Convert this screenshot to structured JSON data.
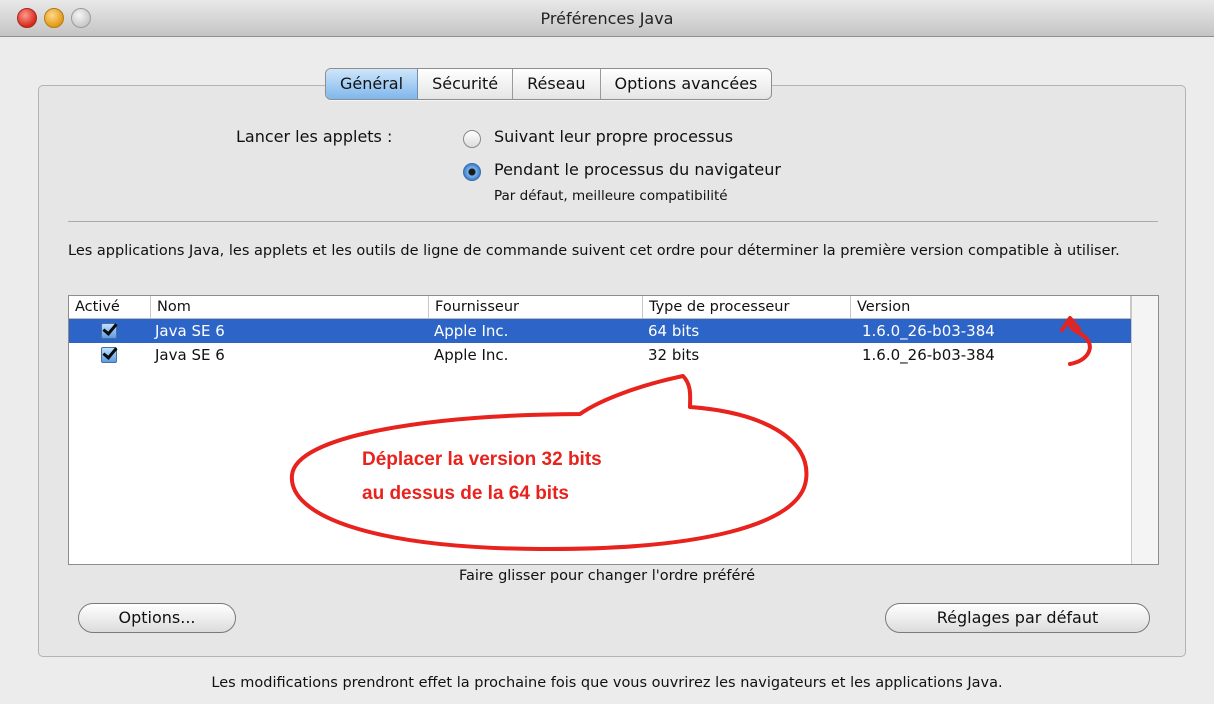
{
  "window": {
    "title": "Préférences Java"
  },
  "tabs": [
    {
      "label": "Général",
      "active": true
    },
    {
      "label": "Sécurité",
      "active": false
    },
    {
      "label": "Réseau",
      "active": false
    },
    {
      "label": "Options avancées",
      "active": false
    }
  ],
  "applets": {
    "label": "Lancer les applets :",
    "options": [
      {
        "label": "Suivant leur propre processus",
        "selected": false
      },
      {
        "label": "Pendant le processus du navigateur",
        "selected": true
      }
    ],
    "hint": "Par défaut, meilleure compatibilité"
  },
  "description": "Les applications Java, les applets et les outils de ligne de commande suivent cet ordre pour déterminer la première version compatible à utiliser.",
  "table": {
    "columns": [
      "Activé",
      "Nom",
      "Fournisseur",
      "Type de processeur",
      "Version"
    ],
    "rows": [
      {
        "enabled": true,
        "name": "Java SE 6",
        "vendor": "Apple Inc.",
        "type": "64 bits",
        "version": "1.6.0_26-b03-384",
        "selected": true
      },
      {
        "enabled": true,
        "name": "Java SE 6",
        "vendor": "Apple Inc.",
        "type": "32 bits",
        "version": "1.6.0_26-b03-384",
        "selected": false
      }
    ]
  },
  "drag_hint": "Faire glisser pour changer l'ordre préféré",
  "buttons": {
    "options": "Options...",
    "defaults": "Réglages par défaut"
  },
  "footer_note": "Les modifications prendront effet la prochaine fois que vous ouvrirez les navigateurs et les applications Java.",
  "annotation": {
    "line1": "Déplacer la version 32 bits",
    "line2": "au dessus de la 64 bits",
    "color": "#e8221d"
  },
  "colors": {
    "selection": "#2d64c8",
    "tab_active": "#7fb7ec"
  }
}
